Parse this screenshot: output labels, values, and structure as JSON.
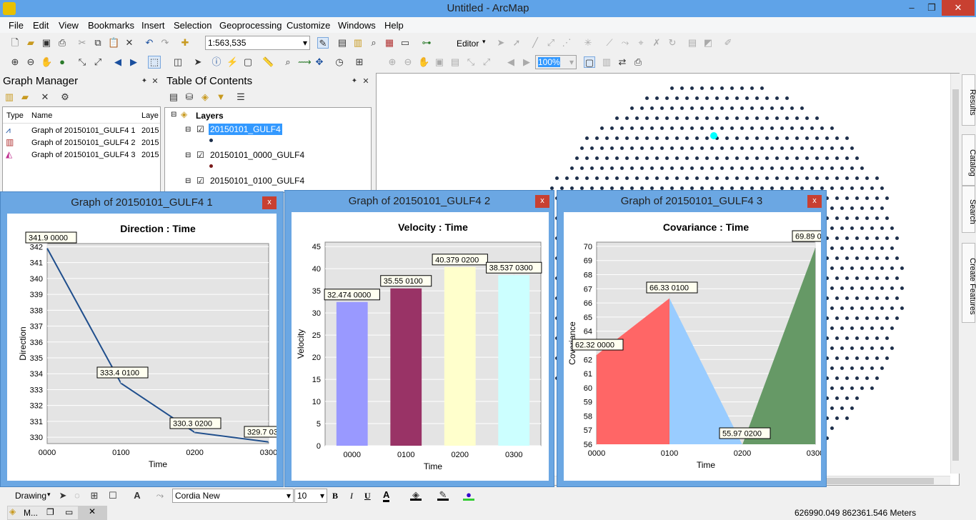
{
  "window": {
    "title": "Untitled - ArcMap",
    "minimize": "–",
    "restore": "❐",
    "close": "✕"
  },
  "menu": [
    "File",
    "Edit",
    "View",
    "Bookmarks",
    "Insert",
    "Selection",
    "Geoprocessing",
    "Customize",
    "Windows",
    "Help"
  ],
  "toolbar": {
    "scale": "1:563,535",
    "editor_label": "Editor",
    "zoom_value": "100%"
  },
  "graph_manager": {
    "title": "Graph Manager",
    "columns": [
      "Type",
      "Name",
      "Laye"
    ],
    "rows": [
      {
        "name": "Graph of 20150101_GULF4 1",
        "layer": "2015"
      },
      {
        "name": "Graph of 20150101_GULF4 2",
        "layer": "2015"
      },
      {
        "name": "Graph of 20150101_GULF4 3",
        "layer": "2015"
      }
    ]
  },
  "toc": {
    "title": "Table Of Contents",
    "root": "Layers",
    "layers": [
      "20150101_GULF4",
      "20150101_0000_GULF4",
      "20150101_0100_GULF4"
    ]
  },
  "right_tabs": [
    "Results",
    "Catalog",
    "Search",
    "Create Features"
  ],
  "drawing_toolbar": {
    "drawing_label": "Drawing",
    "font": "Cordia New",
    "size": "10",
    "bold": "B",
    "italic": "I",
    "underline": "U",
    "font_color": "A"
  },
  "status": {
    "coords": "626990.049  862361.546 Meters",
    "taskbar_label": "M..."
  },
  "colors": {
    "accent": "#5fa3e8",
    "selected_layer": "#3399ff",
    "close_red": "#c84031"
  },
  "graphs": [
    {
      "window_title": "Graph of 20150101_GULF4 1",
      "close": "x",
      "chart_data": {
        "type": "line",
        "title": "Direction : Time",
        "xlabel": "Time",
        "ylabel": "Direction",
        "categories": [
          "0000",
          "0100",
          "0200",
          "0300"
        ],
        "values": [
          341.9,
          333.4,
          330.3,
          329.7
        ],
        "data_labels": [
          "341.9 0000",
          "333.4 0100",
          "330.3 0200",
          "329.7 03"
        ],
        "yticks": [
          330,
          331,
          332,
          333,
          334,
          335,
          336,
          337,
          338,
          339,
          340,
          341,
          342
        ],
        "ylim": [
          329.6,
          342.2
        ],
        "color": "#1f4e8c"
      }
    },
    {
      "window_title": "Graph of 20150101_GULF4 2",
      "close": "x",
      "chart_data": {
        "type": "bar",
        "title": "Velocity : Time",
        "xlabel": "Time",
        "ylabel": "Velocity",
        "categories": [
          "0000",
          "0100",
          "0200",
          "0300"
        ],
        "values": [
          32.474,
          35.55,
          40.379,
          38.537
        ],
        "data_labels": [
          "32.474 0000",
          "35.55 0100",
          "40.379 0200",
          "38.537 0300"
        ],
        "yticks": [
          0,
          5,
          10,
          15,
          20,
          25,
          30,
          35,
          40,
          45
        ],
        "ylim": [
          0,
          46
        ],
        "colors": [
          "#9999ff",
          "#993366",
          "#ffffcc",
          "#ccffff"
        ]
      }
    },
    {
      "window_title": "Graph of 20150101_GULF4 3",
      "close": "x",
      "chart_data": {
        "type": "area",
        "title": "Covariance : Time",
        "xlabel": "Time",
        "ylabel": "Covariance",
        "categories": [
          "0000",
          "0100",
          "0200",
          "0300"
        ],
        "values": [
          62.32,
          66.33,
          55.97,
          69.89
        ],
        "data_labels": [
          "62.32 0000",
          "66.33 0100",
          "55.97 0200",
          "69.89 0"
        ],
        "yticks": [
          56,
          57,
          58,
          59,
          60,
          61,
          62,
          63,
          64,
          65,
          66,
          67,
          68,
          69,
          70
        ],
        "ylim": [
          56,
          70.3
        ],
        "colors": [
          "#ff6666",
          "#99ccff",
          "#669966"
        ]
      }
    }
  ]
}
